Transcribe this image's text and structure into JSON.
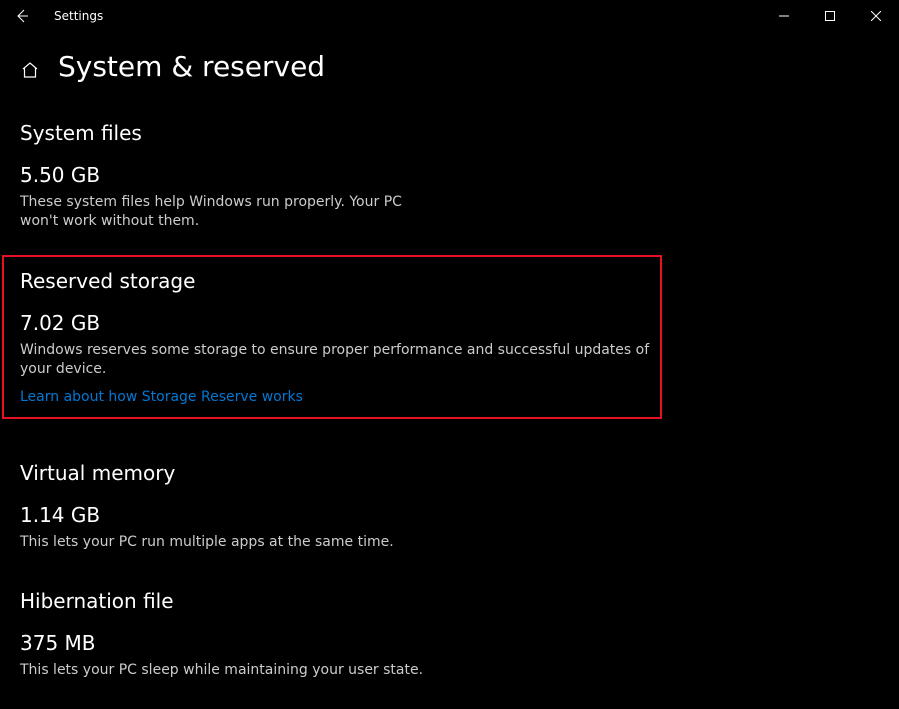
{
  "window": {
    "title": "Settings"
  },
  "header": {
    "title": "System & reserved"
  },
  "sections": {
    "system_files": {
      "heading": "System files",
      "value": "5.50 GB",
      "desc": "These system files help Windows run properly. Your PC won't work without them."
    },
    "reserved_storage": {
      "heading": "Reserved storage",
      "value": "7.02 GB",
      "desc": "Windows reserves some storage to ensure proper performance and successful updates of your device.",
      "link": "Learn about how Storage Reserve works"
    },
    "virtual_memory": {
      "heading": "Virtual memory",
      "value": "1.14 GB",
      "desc": "This lets your PC run multiple apps at the same time."
    },
    "hibernation_file": {
      "heading": "Hibernation file",
      "value": "375 MB",
      "desc": "This lets your PC sleep while maintaining your user state."
    }
  },
  "annotation": {
    "highlight_color": "#e81123"
  }
}
